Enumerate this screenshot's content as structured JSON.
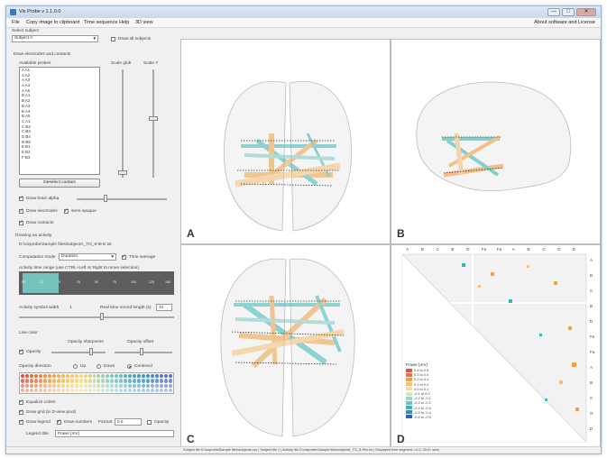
{
  "window": {
    "title": "Vis Probe v 1.1.0.0",
    "minimize": "—",
    "maximize": "□",
    "close": "✕"
  },
  "menu": {
    "items": [
      "File",
      "Copy image to clipboard",
      "Time sequence",
      "Help",
      "3D view"
    ],
    "about": "About software and License"
  },
  "left_panel": {
    "select_subject_label": "Select subject",
    "subject_value": "Subject A",
    "draw_all_subjects": "Draw all subjects",
    "draw_electrodes_label": "Draw electrodes and contacts",
    "available_probes_label": "Available probes",
    "scale_glob_label": "Scale glob",
    "scale_y_label": "Scale Y",
    "probes": [
      "A A1",
      "A A2",
      "A A3",
      "A A4",
      "A A5",
      "B A1",
      "B A2",
      "B A3",
      "B A4",
      "B A5",
      "C A1",
      "C B2",
      "C B3",
      "D B4",
      "D B5",
      "E B1",
      "E B2",
      "F B3"
    ],
    "deselect_contact": "Deselect contact",
    "draw_brain_alpha": "Draw brain alpha",
    "draw_electrodes": "Draw electrodes",
    "semi_opaque": "semi-opaque",
    "draw_contacts": "Draw contacts",
    "drawing_activity_label": "Drawing an activity",
    "activity_file_path": "D:\\vizprobe\\Sample files\\subjectA_TG_8-9Hz.txt",
    "computation_mode_label": "Computation mode",
    "computation_mode_value": "Duration",
    "time_average": "Time average",
    "activity_time_range_label": "Activity time range (use CTRL+Left or Right to move selection)",
    "timeline_labels": [
      "-50",
      "-25",
      "0",
      "25",
      "50",
      "75",
      "100",
      "125",
      "150"
    ],
    "activity_symbol_width_label": "Activity symbol width",
    "activity_symbol_width_value": "1",
    "realtime_record_label": "Real time record length (s)",
    "realtime_record_value": "10",
    "line_color_label": "Line color",
    "opacity": "Opacity",
    "opacity_sharpness": "Opacity sharpness",
    "opacity_offset": "Opacity offset",
    "opacity_direction_label": "Opacity direction",
    "direction_options": [
      "Up",
      "Down",
      "Centered"
    ],
    "equalize_colors": "Equalize colors",
    "draw_grid": "Draw grid (in D-view pool)",
    "draw_legend": "Draw legend",
    "draw_numbers": "Draw numbers",
    "format_label": "Format",
    "format_value": "0.0",
    "opacity_right": "Opacity",
    "legend_title_label": "Legend title",
    "legend_title_value": "Power [mV]"
  },
  "views": {
    "A": "A",
    "B": "B",
    "C": "C",
    "D": "D"
  },
  "matrix": {
    "column_labels": [
      "A",
      "B",
      "C",
      "B",
      "D",
      "Fe",
      "Fa",
      "A",
      "B",
      "C",
      "O",
      "D"
    ],
    "row_labels": [
      "A",
      "B",
      "C",
      "B",
      "D",
      "Fe",
      "Fa",
      "A",
      "B",
      "C",
      "O",
      "D"
    ],
    "legend_title": "Power [mV]",
    "legend_entries": [
      "0.4 to 0.5",
      "0.3 to 0.4",
      "0.2 to 0.3",
      "0.1 to 0.2",
      "0.0 to 0.1",
      "-0.1 to 0.0",
      "-0.2 to -0.1",
      "-0.3 to -0.2",
      "-0.4 to -0.3",
      "-0.5 to -0.4",
      "-0.6 to -0.5"
    ]
  },
  "colors": {
    "teal": "#3ab7b3",
    "orange": "#f0a040",
    "accent": "#2a5fa8"
  },
  "status": {
    "text": "Subject file D:\\vizprobe\\Sample files\\subjects.csv  |  Subject file 1  |  Activity file D:\\vizprobe\\Sample files\\subjectA_TG_8-9Hz.txt  |  Displayed time segment: <2.0; 25.0> secs"
  }
}
